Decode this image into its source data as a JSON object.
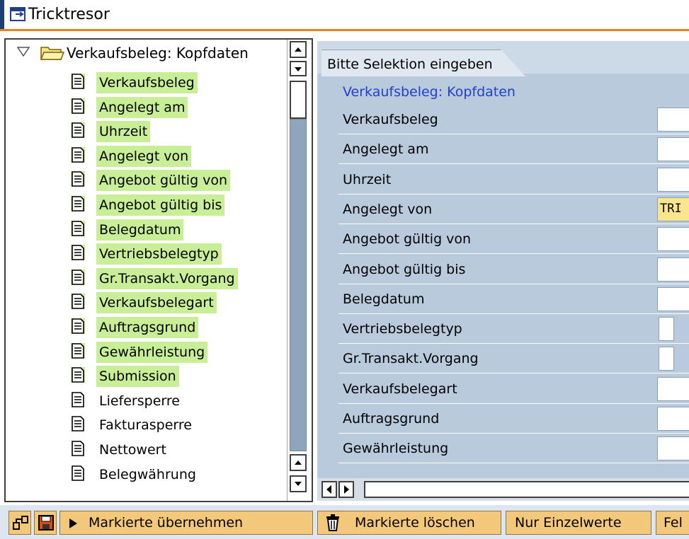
{
  "window": {
    "title": "Tricktresor"
  },
  "tree": {
    "root": {
      "label": "Verkaufsbeleg: Kopfdaten",
      "expanded": true
    },
    "items": [
      {
        "label": "Verkaufsbeleg",
        "highlighted": true
      },
      {
        "label": "Angelegt am",
        "highlighted": true
      },
      {
        "label": "Uhrzeit",
        "highlighted": true
      },
      {
        "label": "Angelegt von",
        "highlighted": true
      },
      {
        "label": "Angebot gültig von",
        "highlighted": true
      },
      {
        "label": "Angebot gültig bis",
        "highlighted": true
      },
      {
        "label": "Belegdatum",
        "highlighted": true
      },
      {
        "label": "Vertriebsbelegtyp",
        "highlighted": true
      },
      {
        "label": "Gr.Transakt.Vorgang",
        "highlighted": true
      },
      {
        "label": "Verkaufsbelegart",
        "highlighted": true
      },
      {
        "label": "Auftragsgrund",
        "highlighted": true
      },
      {
        "label": "Gewährleistung",
        "highlighted": true
      },
      {
        "label": "Submission",
        "highlighted": true
      },
      {
        "label": "Liefersperre",
        "highlighted": false
      },
      {
        "label": "Fakturasperre",
        "highlighted": false
      },
      {
        "label": "Nettowert",
        "highlighted": false
      },
      {
        "label": "Belegwährung",
        "highlighted": false
      }
    ]
  },
  "selection": {
    "tab_label": "Bitte Selektion eingeben",
    "section_title": "Verkaufsbeleg: Kopfdaten",
    "fields": [
      {
        "label": "Verkaufsbeleg",
        "value": "",
        "size": "wide"
      },
      {
        "label": "Angelegt am",
        "value": "",
        "size": "wide"
      },
      {
        "label": "Uhrzeit",
        "value": "",
        "size": "wide"
      },
      {
        "label": "Angelegt von",
        "value": "TRI",
        "size": "wide",
        "highlighted": true
      },
      {
        "label": "Angebot gültig von",
        "value": "",
        "size": "wide"
      },
      {
        "label": "Angebot gültig bis",
        "value": "",
        "size": "wide"
      },
      {
        "label": "Belegdatum",
        "value": "",
        "size": "wide"
      },
      {
        "label": "Vertriebsbelegtyp",
        "value": "",
        "size": "narrow"
      },
      {
        "label": "Gr.Transakt.Vorgang",
        "value": "",
        "size": "narrow"
      },
      {
        "label": "Verkaufsbelegart",
        "value": "",
        "size": "wide"
      },
      {
        "label": "Auftragsgrund",
        "value": "",
        "size": "wide"
      },
      {
        "label": "Gewährleistung",
        "value": "",
        "size": "wide"
      }
    ]
  },
  "toolbar": {
    "transfer_label": "Markierte übernehmen",
    "delete_label": "Markierte löschen",
    "single_values_label": "Nur Einzelwerte",
    "truncated_label": "Fel"
  },
  "colors": {
    "highlight_green": "#c8ee98",
    "input_highlight": "#fbe68e",
    "button_bg": "#f4c87a",
    "section_title": "#1f3fd0",
    "accent_line": "#e2841a"
  }
}
